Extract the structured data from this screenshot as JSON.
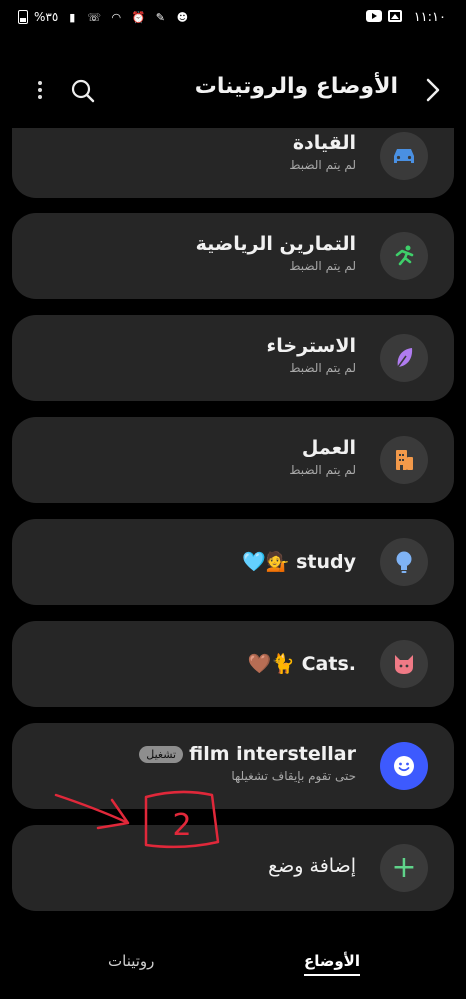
{
  "status_bar": {
    "time": "١١:١٠",
    "battery": "%٣٥"
  },
  "header": {
    "title": "الأوضاع والروتينات",
    "back_icon": "chevron-right-icon",
    "search_icon": "search-icon",
    "more_icon": "more-vertical-icon"
  },
  "modes": [
    {
      "title": "القيادة",
      "subtitle": "لم يتم الضبط",
      "icon": "car-icon",
      "icon_color": "#4a90e2"
    },
    {
      "title": "التمارين الرياضية",
      "subtitle": "لم يتم الضبط",
      "icon": "running-icon",
      "icon_color": "#3ecf6a"
    },
    {
      "title": "الاسترخاء",
      "subtitle": "لم يتم الضبط",
      "icon": "leaf-icon",
      "icon_color": "#b07cf0"
    },
    {
      "title": "العمل",
      "subtitle": "لم يتم الضبط",
      "icon": "building-icon",
      "icon_color": "#f2994a"
    },
    {
      "title": "study 💁🩵",
      "subtitle": "",
      "icon": "lightbulb-icon",
      "icon_color": "#7fb3f5"
    },
    {
      "title": ".Cats 🐈🤎",
      "subtitle": "",
      "icon": "cat-icon",
      "icon_color": "#f07a86"
    },
    {
      "title": "film interstellar",
      "badge": "تشغيل",
      "subtitle": "حتى تقوم بإيقاف تشغيلها",
      "icon": "smile-icon",
      "icon_color": "#3d5afe"
    }
  ],
  "add_mode": {
    "label": "إضافة وضع",
    "icon": "plus-icon",
    "icon_color": "#5fd38a"
  },
  "annotation": {
    "text": "2",
    "color": "#e0283a"
  },
  "tabs": {
    "modes": "الأوضاع",
    "routines": "روتينات"
  }
}
